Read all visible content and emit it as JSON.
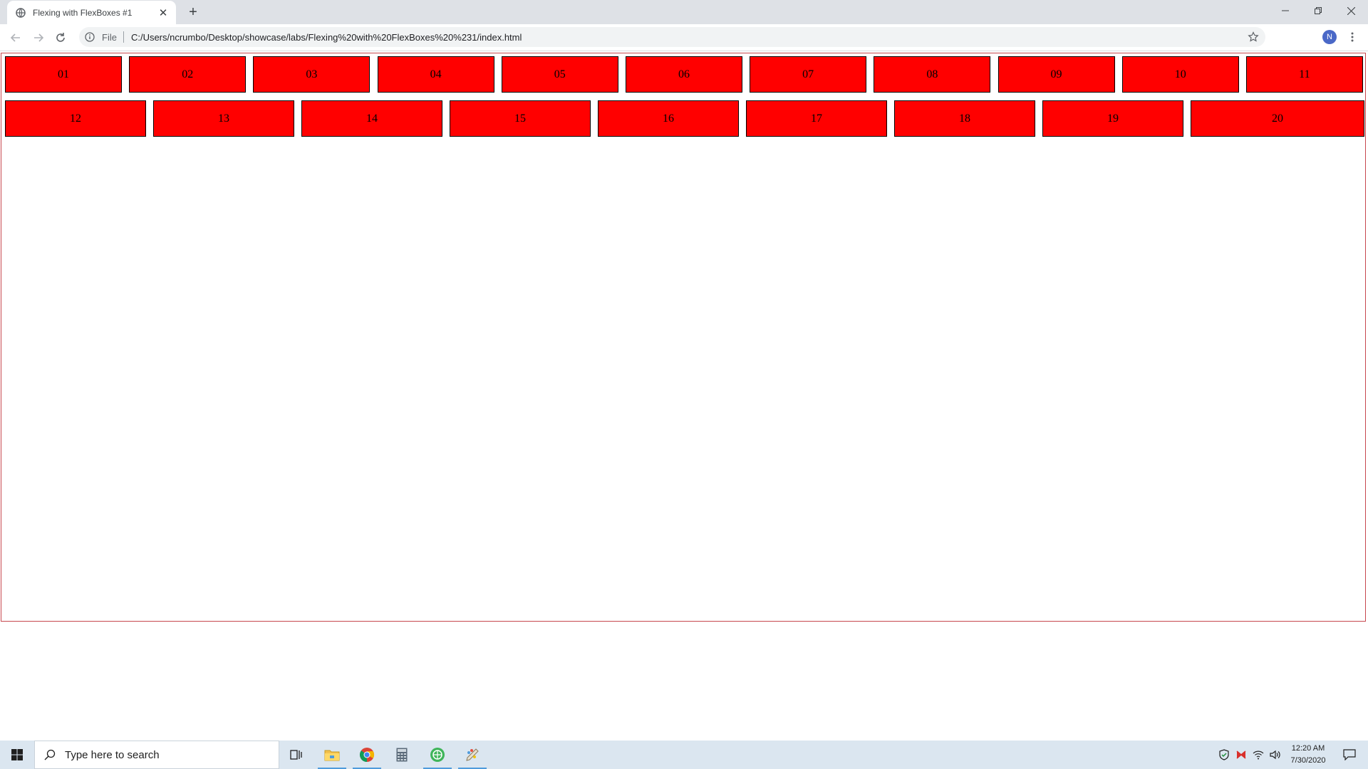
{
  "browser": {
    "tab_title": "Flexing with FlexBoxes #1",
    "scheme_label": "File",
    "url": "C:/Users/ncrumbo/Desktop/showcase/labs/Flexing%20with%20FlexBoxes%20%231/index.html",
    "avatar_initial": "N"
  },
  "page": {
    "row1": [
      "01",
      "02",
      "03",
      "04",
      "05",
      "06",
      "07",
      "08",
      "09",
      "10",
      "11"
    ],
    "row2": [
      "12",
      "13",
      "14",
      "15",
      "16",
      "17",
      "18",
      "19",
      "20"
    ],
    "colors": {
      "box_fill": "#ff0000",
      "box_border": "#000000",
      "container_border": "#c7474e"
    }
  },
  "taskbar": {
    "search_placeholder": "Type here to search",
    "time": "12:20 AM",
    "date": "7/30/2020",
    "icons": [
      "windows-start-icon",
      "search-icon",
      "task-view-icon",
      "file-explorer-icon",
      "chrome-icon",
      "calculator-icon",
      "app-globe-icon",
      "paint-icon",
      "security-icon",
      "app-tray-icon",
      "network-icon",
      "volume-icon",
      "notification-icon"
    ]
  }
}
